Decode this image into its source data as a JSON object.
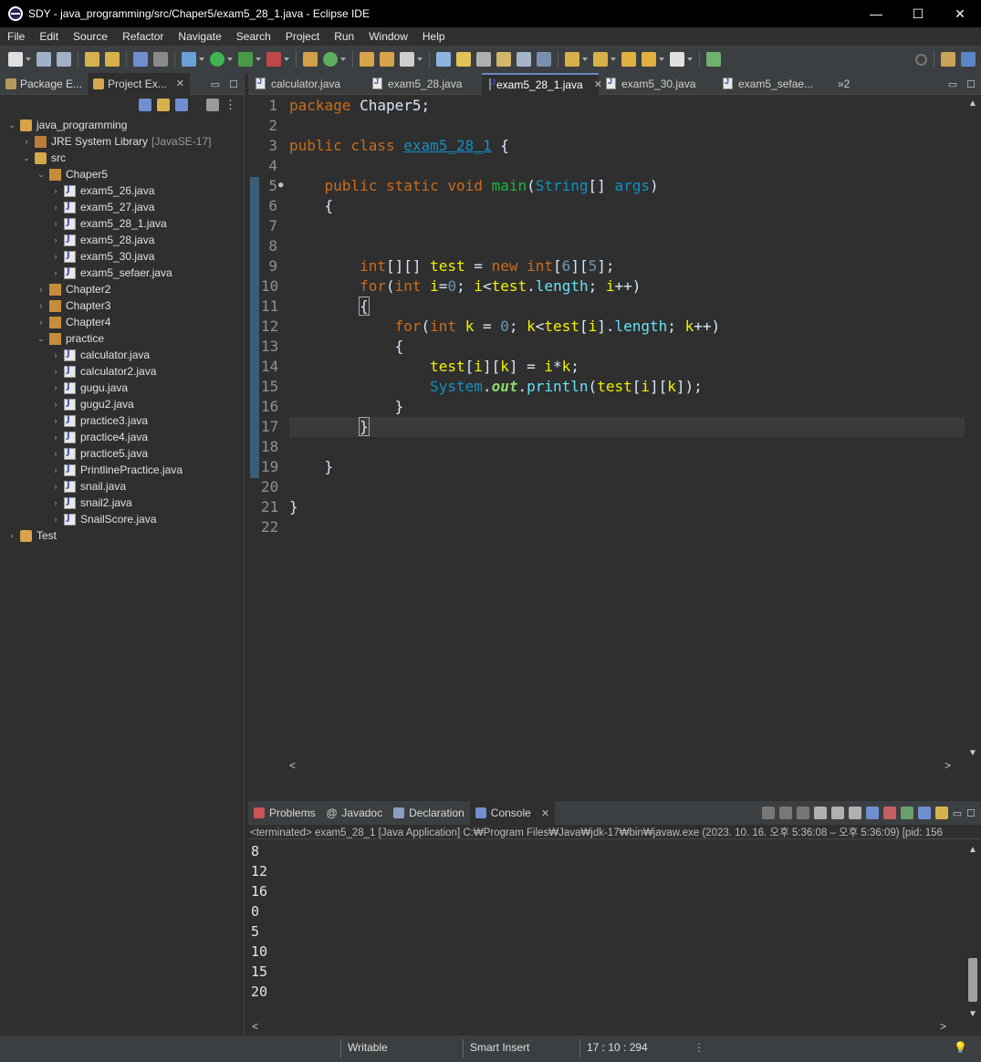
{
  "window": {
    "title": "SDY - java_programming/src/Chaper5/exam5_28_1.java - Eclipse IDE",
    "minimize": "—",
    "maximize": "☐",
    "close": "✕"
  },
  "menu": [
    "File",
    "Edit",
    "Source",
    "Refactor",
    "Navigate",
    "Search",
    "Project",
    "Run",
    "Window",
    "Help"
  ],
  "left_panel": {
    "tabs": [
      {
        "label": "Package E...",
        "active": false
      },
      {
        "label": "Project Ex...",
        "active": true
      }
    ],
    "tree": [
      {
        "label": "java_programming",
        "level": 0,
        "expanded": true,
        "icon": "project"
      },
      {
        "label": "JRE System Library",
        "suffix": "[JavaSE-17]",
        "level": 1,
        "expanded": false,
        "icon": "library"
      },
      {
        "label": "src",
        "level": 1,
        "expanded": true,
        "icon": "folder"
      },
      {
        "label": "Chaper5",
        "level": 2,
        "expanded": true,
        "icon": "package"
      },
      {
        "label": "exam5_26.java",
        "level": 3,
        "icon": "java"
      },
      {
        "label": "exam5_27.java",
        "level": 3,
        "icon": "java"
      },
      {
        "label": "exam5_28_1.java",
        "level": 3,
        "icon": "java"
      },
      {
        "label": "exam5_28.java",
        "level": 3,
        "icon": "java"
      },
      {
        "label": "exam5_30.java",
        "level": 3,
        "icon": "java"
      },
      {
        "label": "exam5_sefaer.java",
        "level": 3,
        "icon": "java"
      },
      {
        "label": "Chapter2",
        "level": 2,
        "expanded": false,
        "icon": "package"
      },
      {
        "label": "Chapter3",
        "level": 2,
        "expanded": false,
        "icon": "package"
      },
      {
        "label": "Chapter4",
        "level": 2,
        "expanded": false,
        "icon": "package"
      },
      {
        "label": "practice",
        "level": 2,
        "expanded": true,
        "icon": "package"
      },
      {
        "label": "calculator.java",
        "level": 3,
        "icon": "java"
      },
      {
        "label": "calculator2.java",
        "level": 3,
        "icon": "java"
      },
      {
        "label": "gugu.java",
        "level": 3,
        "icon": "java"
      },
      {
        "label": "gugu2.java",
        "level": 3,
        "icon": "java"
      },
      {
        "label": "practice3.java",
        "level": 3,
        "icon": "java"
      },
      {
        "label": "practice4.java",
        "level": 3,
        "icon": "java"
      },
      {
        "label": "practice5.java",
        "level": 3,
        "icon": "java"
      },
      {
        "label": "PrintlinePractice.java",
        "level": 3,
        "icon": "java"
      },
      {
        "label": "snail.java",
        "level": 3,
        "icon": "java"
      },
      {
        "label": "snail2.java",
        "level": 3,
        "icon": "java"
      },
      {
        "label": "SnailScore.java",
        "level": 3,
        "icon": "java"
      },
      {
        "label": "Test",
        "level": 0,
        "expanded": false,
        "icon": "project"
      }
    ]
  },
  "editor": {
    "tabs": [
      {
        "label": "calculator.java",
        "active": false
      },
      {
        "label": "exam5_28.java",
        "active": false
      },
      {
        "label": "exam5_28_1.java",
        "active": true
      },
      {
        "label": "exam5_30.java",
        "active": false
      },
      {
        "label": "exam5_sefae...",
        "active": false
      }
    ],
    "overflow": "»2",
    "current_line": 17,
    "line_numbers": [
      "1",
      "2",
      "3",
      "4",
      "5",
      "6",
      "7",
      "8",
      "9",
      "10",
      "11",
      "12",
      "13",
      "14",
      "15",
      "16",
      "17",
      "18",
      "19",
      "20",
      "21",
      "22"
    ]
  },
  "console": {
    "tabs": [
      {
        "label": "Problems",
        "active": false
      },
      {
        "label": "Javadoc",
        "active": false
      },
      {
        "label": "Declaration",
        "active": false
      },
      {
        "label": "Console",
        "active": true
      }
    ],
    "status": "<terminated> exam5_28_1 [Java Application] C:₩Program Files₩Java₩jdk-17₩bin₩javaw.exe  (2023. 10. 16. 오후 5:36:08 – 오후 5:36:09) [pid: 156",
    "output": [
      "8",
      "12",
      "16",
      "0",
      "5",
      "10",
      "15",
      "20"
    ]
  },
  "statusbar": {
    "writable": "Writable",
    "insert_mode": "Smart Insert",
    "position": "17 : 10 : 294"
  }
}
